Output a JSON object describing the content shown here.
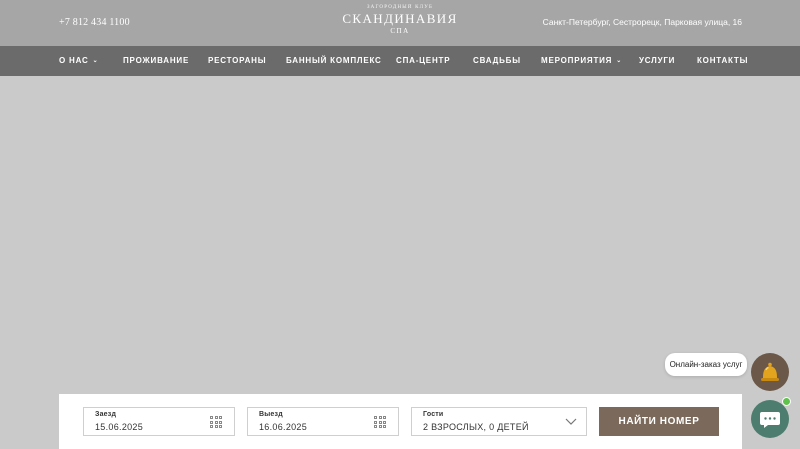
{
  "header": {
    "phone": "+7 812 434 1100",
    "logo_small": "ЗАГОРОДНЫЙ КЛУБ",
    "logo_main": "СКАНДИНАВИЯ",
    "logo_sub": "СПА",
    "address": "Санкт-Петербург, Сестрорецк, Парковая улица, 16"
  },
  "nav": {
    "items": [
      {
        "label": "О НАС",
        "has_dropdown": true
      },
      {
        "label": "ПРОЖИВАНИЕ",
        "has_dropdown": false
      },
      {
        "label": "РЕСТОРАНЫ",
        "has_dropdown": false
      },
      {
        "label": "БАННЫЙ КОМПЛЕКС",
        "has_dropdown": false
      },
      {
        "label": "СПА-ЦЕНТР",
        "has_dropdown": false
      },
      {
        "label": "СВАДЬБЫ",
        "has_dropdown": false
      },
      {
        "label": "МЕРОПРИЯТИЯ",
        "has_dropdown": true
      },
      {
        "label": "УСЛУГИ",
        "has_dropdown": false
      },
      {
        "label": "КОНТАКТЫ",
        "has_dropdown": false
      }
    ]
  },
  "booking": {
    "checkin": {
      "label": "Заезд",
      "value": "15.06.2025"
    },
    "checkout": {
      "label": "Выезд",
      "value": "16.06.2025"
    },
    "guests": {
      "label": "Гости",
      "value": "2 ВЗРОСЛЫХ, 0 ДЕТЕЙ"
    },
    "search_label": "НАЙТИ НОМЕР"
  },
  "widgets": {
    "service_order": "Онлайн-заказ услуг",
    "bell_icon": "bell-icon",
    "chat_icon": "chat-icon"
  },
  "colors": {
    "topbar": "#a6a6a6",
    "navbar": "#6b6b6b",
    "hero": "#cacaca",
    "accent": "#7b6a5b",
    "chat": "#4d7d6e",
    "online": "#5fc24a"
  }
}
